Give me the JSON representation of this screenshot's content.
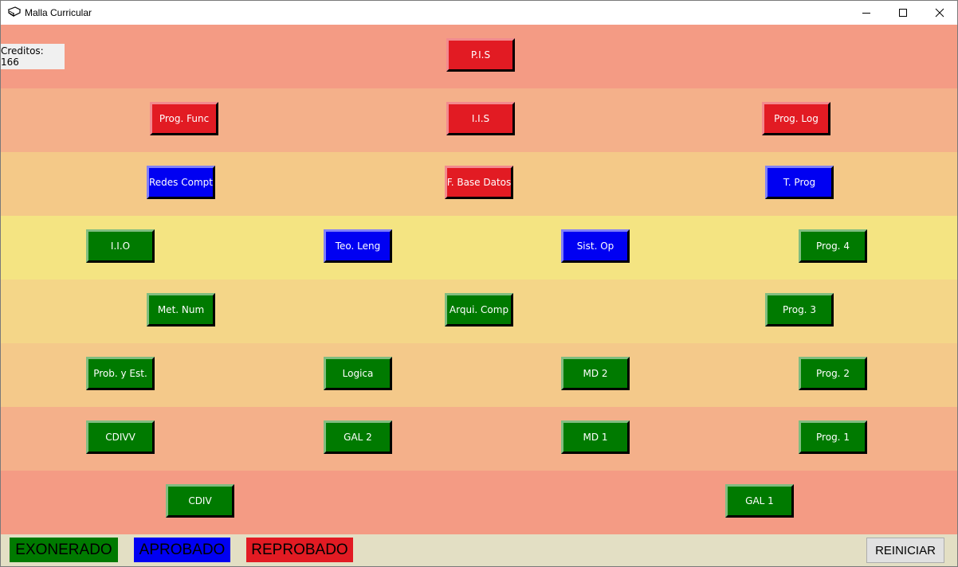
{
  "window": {
    "title": "Malla Curricular",
    "app_icon": "book-icon"
  },
  "window_controls": {
    "minimize": "minimize-icon",
    "maximize": "maximize-icon",
    "close": "close-icon"
  },
  "colors": {
    "row_backgrounds": [
      "#f49b84",
      "#f4b08a",
      "#f4c988",
      "#f4e482",
      "#f4d688",
      "#f4c98a",
      "#f4b08a",
      "#f49b84"
    ],
    "status": {
      "exonerado": "#007a00",
      "aprobado": "#0000f2",
      "reprobado": "#e21b23"
    },
    "footer": "#e3dfc4"
  },
  "credits": {
    "label": "Creditos: 166"
  },
  "courses": [
    {
      "label": "P.I.S",
      "status": "reprobado"
    },
    {
      "label": "Prog. Func",
      "status": "reprobado"
    },
    {
      "label": "I.I.S",
      "status": "reprobado"
    },
    {
      "label": "Prog. Log",
      "status": "reprobado"
    },
    {
      "label": "Redes Compt",
      "status": "aprobado"
    },
    {
      "label": "F. Base Datos",
      "status": "reprobado"
    },
    {
      "label": "T. Prog",
      "status": "aprobado"
    },
    {
      "label": "I.I.O",
      "status": "exonerado"
    },
    {
      "label": "Teo. Leng",
      "status": "aprobado"
    },
    {
      "label": "Sist. Op",
      "status": "aprobado"
    },
    {
      "label": "Prog. 4",
      "status": "exonerado"
    },
    {
      "label": "Met. Num",
      "status": "exonerado"
    },
    {
      "label": "Arqui. Comp",
      "status": "exonerado"
    },
    {
      "label": "Prog. 3",
      "status": "exonerado"
    },
    {
      "label": "Prob. y Est.",
      "status": "exonerado"
    },
    {
      "label": "Logica",
      "status": "exonerado"
    },
    {
      "label": "MD 2",
      "status": "exonerado"
    },
    {
      "label": "Prog. 2",
      "status": "exonerado"
    },
    {
      "label": "CDIVV",
      "status": "exonerado"
    },
    {
      "label": "GAL 2",
      "status": "exonerado"
    },
    {
      "label": "MD 1",
      "status": "exonerado"
    },
    {
      "label": "Prog. 1",
      "status": "exonerado"
    },
    {
      "label": "CDIV",
      "status": "exonerado"
    },
    {
      "label": "GAL 1",
      "status": "exonerado"
    }
  ],
  "legend": {
    "exonerado": "EXONERADO",
    "aprobado": "APROBADO",
    "reprobado": "REPROBADO"
  },
  "reset_button": {
    "label": "REINICIAR"
  }
}
